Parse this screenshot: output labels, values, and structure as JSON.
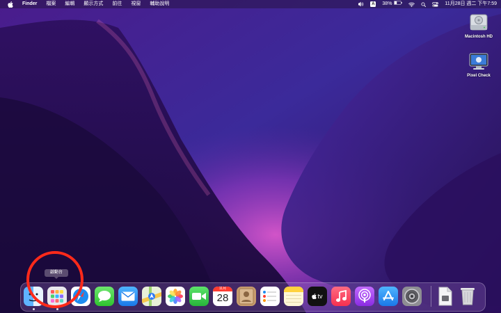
{
  "menubar": {
    "app_name": "Finder",
    "menus": [
      "檔案",
      "編輯",
      "顯示方式",
      "前往",
      "視窗",
      "輔助說明"
    ],
    "input_method": "A",
    "battery_percent": "38%",
    "datetime": "11月28日 週二 下午7:59"
  },
  "desktop": {
    "icons": [
      {
        "label": "Macintosh HD",
        "icon": "hard-drive-icon"
      },
      {
        "label": "Pixel Check",
        "icon": "monitor-app-icon"
      }
    ]
  },
  "dock": {
    "tooltip": "啟動台",
    "calendar": {
      "month": "11月",
      "day": "28"
    },
    "apple_tv_label": "tv",
    "apps": [
      {
        "name": "Finder",
        "icon": "finder-icon",
        "running": true
      },
      {
        "name": "Launchpad",
        "icon": "launchpad-icon",
        "running": true
      },
      {
        "name": "Safari",
        "icon": "safari-icon"
      },
      {
        "name": "Messages",
        "icon": "messages-icon"
      },
      {
        "name": "Mail",
        "icon": "mail-icon"
      },
      {
        "name": "Maps",
        "icon": "maps-icon"
      },
      {
        "name": "Photos",
        "icon": "photos-icon"
      },
      {
        "name": "FaceTime",
        "icon": "facetime-icon"
      },
      {
        "name": "Calendar",
        "icon": "calendar-icon"
      },
      {
        "name": "Contacts",
        "icon": "contacts-icon"
      },
      {
        "name": "Reminders",
        "icon": "reminders-icon"
      },
      {
        "name": "Notes",
        "icon": "notes-icon"
      },
      {
        "name": "Apple TV",
        "icon": "apple-tv-icon"
      },
      {
        "name": "Music",
        "icon": "music-icon"
      },
      {
        "name": "Podcasts",
        "icon": "podcasts-icon"
      },
      {
        "name": "App Store",
        "icon": "app-store-icon"
      },
      {
        "name": "System Preferences",
        "icon": "system-preferences-icon"
      },
      {
        "name": "Document",
        "icon": "document-icon"
      },
      {
        "name": "Trash",
        "icon": "trash-icon"
      }
    ]
  },
  "colors": {
    "highlight": "#ff2a1a",
    "wallpaper_dark": "#1c0b3a",
    "wallpaper_mid": "#5a2aa0",
    "wallpaper_glow": "#c23fb8"
  }
}
